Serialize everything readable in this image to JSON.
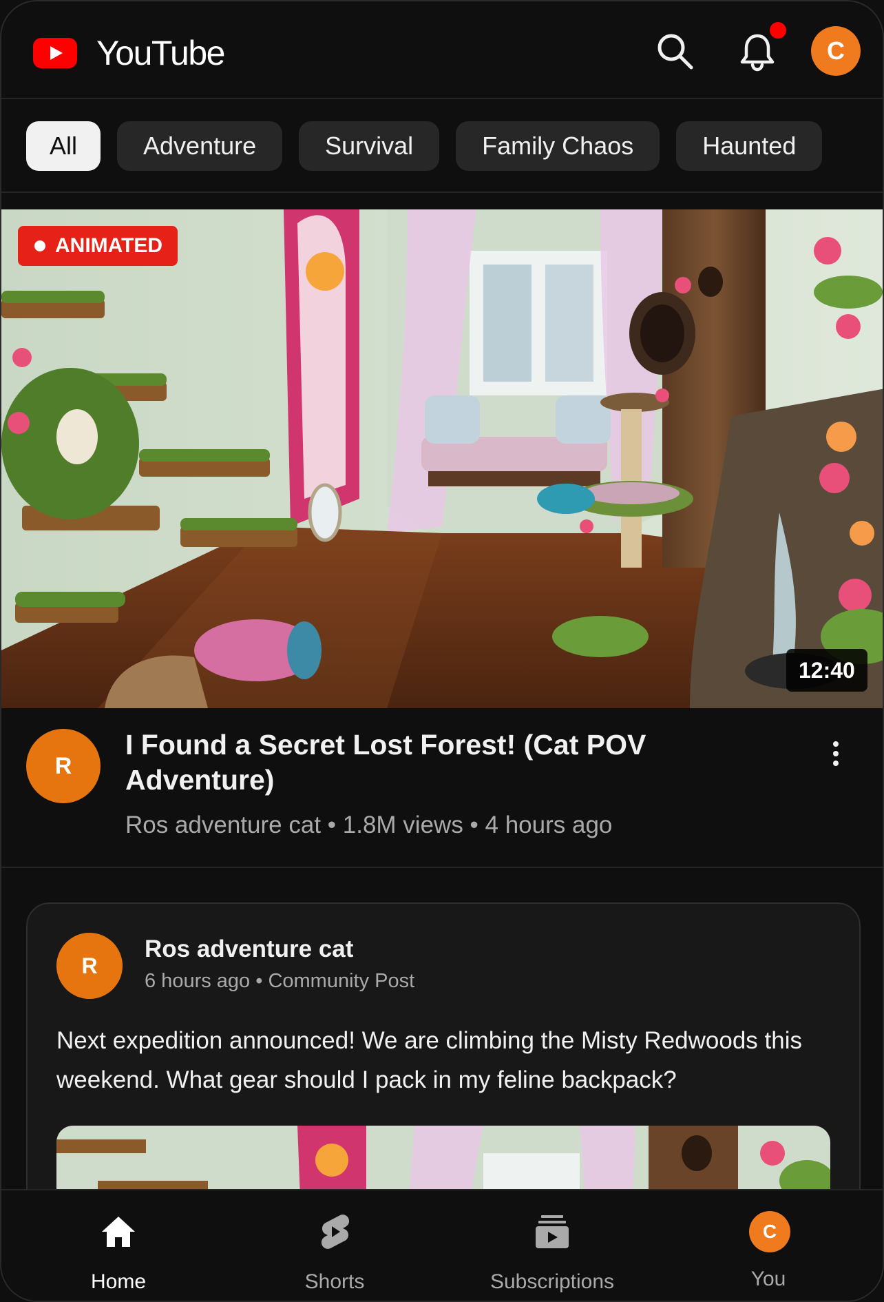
{
  "header": {
    "app_name": "YouTube",
    "notification_dot": true,
    "profile_initial": "C"
  },
  "chips": [
    "All",
    "Adventure",
    "Survival",
    "Family Chaos",
    "Haunted"
  ],
  "video": {
    "badge": "ANIMATED",
    "duration": "12:40",
    "channel_initial": "R",
    "title": "I Found a Secret Lost Forest! (Cat POV Adventure)",
    "channel": "Ros adventure cat",
    "views": "1.8M views",
    "age": "4 hours ago",
    "separator": " • "
  },
  "post": {
    "channel_initial": "R",
    "channel": "Ros adventure cat",
    "meta": "6 hours ago • Community Post",
    "text": "Next expedition announced! We are climbing the Misty Redwoods this weekend. What gear should I pack in my feline backpack?"
  },
  "nav": {
    "items": [
      {
        "label": "Home",
        "icon": "home-icon"
      },
      {
        "label": "Shorts",
        "icon": "shorts-icon"
      },
      {
        "label": "Subscriptions",
        "icon": "subscriptions-icon"
      },
      {
        "label": "You",
        "icon": "avatar"
      }
    ],
    "you_initial": "C"
  },
  "colors": {
    "background": "#0f0f0f",
    "brand_red": "#ff0000",
    "avatar_orange": "#f07a1e",
    "live_badge": "#e62117"
  }
}
